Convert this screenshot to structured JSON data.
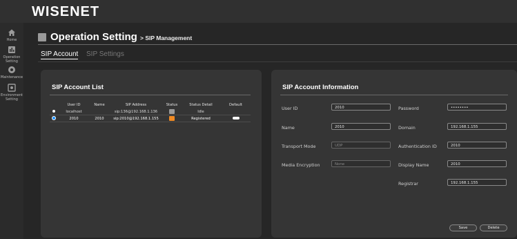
{
  "app": {
    "logo": "WISENET"
  },
  "sidebar": {
    "items": [
      {
        "label": "Home",
        "icon": "home-icon"
      },
      {
        "label": "Operation Setting",
        "icon": "operation-icon"
      },
      {
        "label": "Maintenance",
        "icon": "maintenance-icon"
      },
      {
        "label": "Environment Setting",
        "icon": "environment-icon"
      }
    ]
  },
  "page": {
    "title": "Operation Setting",
    "subtitle": "> SIP Management"
  },
  "tabs": [
    {
      "label": "SIP Account"
    },
    {
      "label": "SIP Settings"
    }
  ],
  "account_list": {
    "title": "SIP Account List",
    "columns": [
      "User ID",
      "Name",
      "SIP Address",
      "Status",
      "Status Detail",
      "Default"
    ],
    "rows": [
      {
        "user_id": "localhost",
        "name": "",
        "sip_address": "sip:136@192.168.1.136",
        "status_color": "#9a9a9a",
        "status_detail": "Idle"
      },
      {
        "user_id": "2010",
        "name": "2010",
        "sip_address": "sip:2010@192.168.1.155",
        "status_color": "#f08a24",
        "status_detail": "Registered"
      }
    ]
  },
  "account_info": {
    "title": "SIP Account Information",
    "fields": {
      "user_id": {
        "label": "User ID",
        "value": "2010"
      },
      "password": {
        "label": "Password",
        "value": "••••••••"
      },
      "name": {
        "label": "Name",
        "value": "2010"
      },
      "domain": {
        "label": "Domain",
        "value": "192.168.1.155"
      },
      "transport": {
        "label": "Transport Mode",
        "value": "UDP"
      },
      "auth_id": {
        "label": "Authentication ID",
        "value": "2010"
      },
      "media_enc": {
        "label": "Media Encryption",
        "value": "None"
      },
      "display_name": {
        "label": "Display Name",
        "value": "2010"
      },
      "registrar": {
        "label": "Registrar",
        "value": "192.168.1.155"
      }
    },
    "save_label": "Save",
    "delete_label": "Delete"
  }
}
